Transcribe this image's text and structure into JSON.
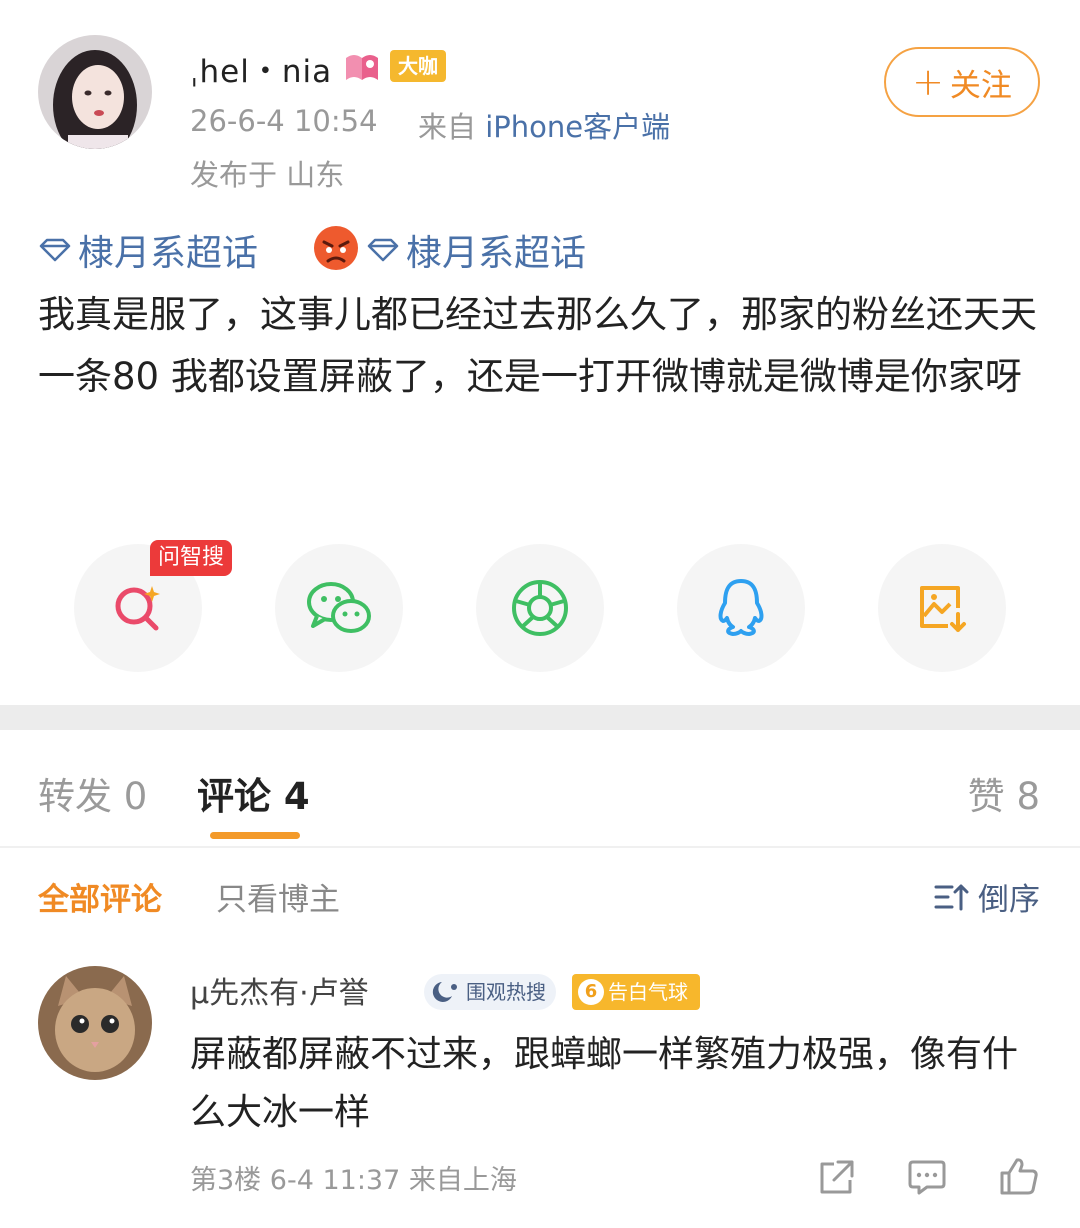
{
  "post": {
    "username": "ˌhel・nia",
    "level_badge": "大咖",
    "time": "26-6-4 10:54",
    "source_prefix": "来自",
    "source_device": "iPhone客户端",
    "location": "发布于 山东",
    "follow_label": "关注",
    "topic_1": "棣月系超话",
    "topic_2": "棣月系超话",
    "body": "我真是服了，这事儿都已经过去那么久了，那家的粉丝还天天一条80 我都设置屏蔽了，还是一打开微博就是微博是你家呀"
  },
  "share": {
    "ai_search_badge": "问智搜",
    "items": [
      "search-icon",
      "wechat-icon",
      "moments-icon",
      "qq-icon",
      "save-image-icon"
    ]
  },
  "tabs": {
    "repost": "转发 0",
    "comments": "评论 4",
    "likes": "赞 8"
  },
  "filters": {
    "all": "全部评论",
    "author_only": "只看博主",
    "sort": "倒序"
  },
  "comment": {
    "username": "μ先杰有·卢誉",
    "hot_badge": "围观热搜",
    "balloon_level": "6",
    "balloon_badge": "告白气球",
    "text": "屏蔽都屏蔽不过来，跟蟑螂一样繁殖力极强，像有什么大冰一样",
    "floor": "第3楼",
    "time": "6-4 11:37",
    "location": "来自上海"
  },
  "colors": {
    "accent_orange": "#f08a24",
    "link_blue": "#4a71a8",
    "badge_gold": "#f5b82e",
    "ai_red": "#ec3a3a"
  }
}
